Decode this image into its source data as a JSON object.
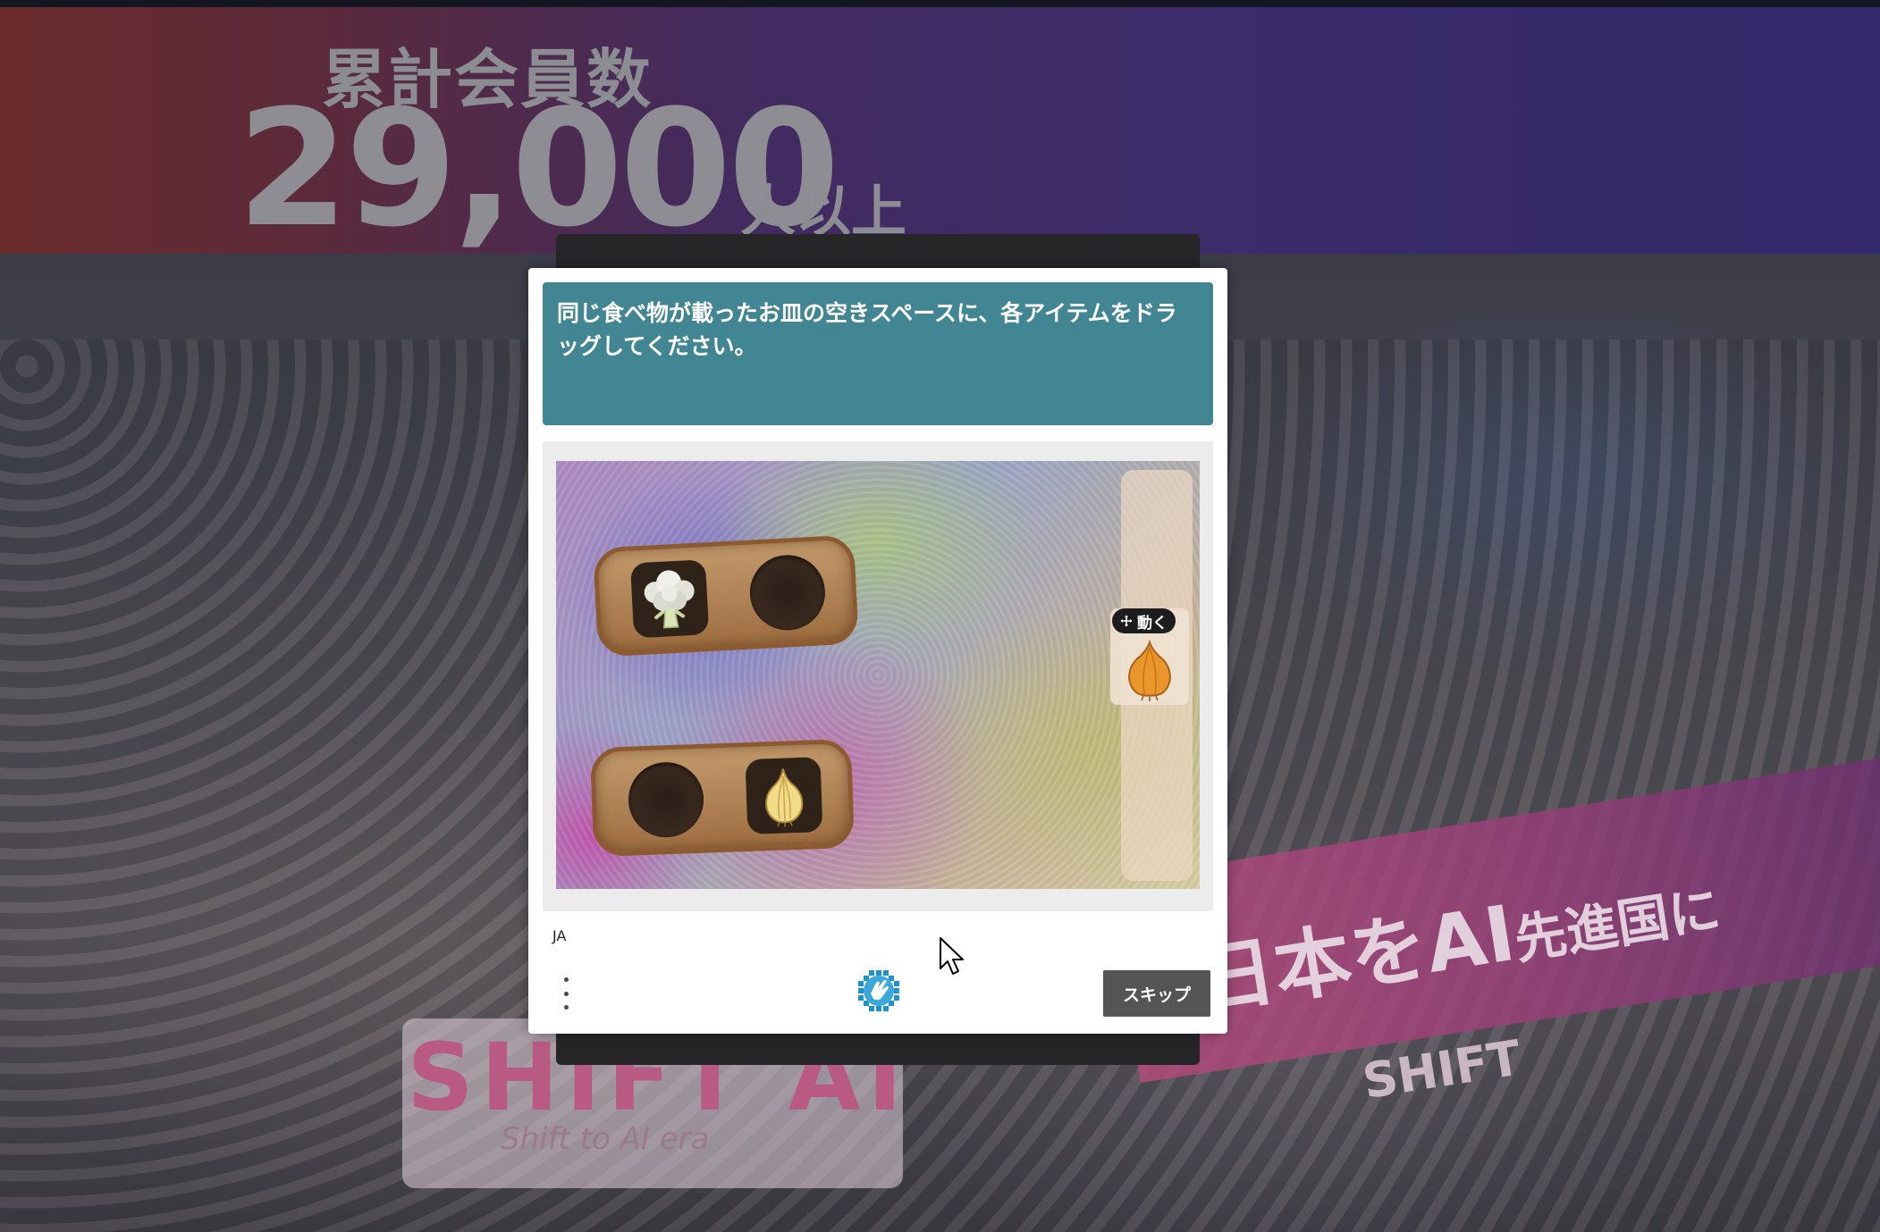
{
  "background": {
    "hero_label": "累計会員数",
    "hero_number": "29,000",
    "hero_unit": "人以上",
    "banner_text": "日本をAI",
    "banner_tail": "先進国に",
    "banner_sub": "SHIFT",
    "sign_text": "SHIFT AI",
    "sign_sub": "Shift to AI era"
  },
  "challenge": {
    "prompt": "同じ食べ物が載ったお皿の空きスペースに、各アイテムをドラッグしてください。",
    "plates": [
      {
        "filled_item": "broccoli",
        "filled_position": "left",
        "empty_position": "right"
      },
      {
        "filled_item": "onion",
        "filled_position": "right",
        "empty_position": "left"
      }
    ],
    "draggable": {
      "badge": "動く",
      "item": "onion"
    },
    "footer": {
      "language": "JA",
      "skip_label": "スキップ"
    }
  },
  "colors": {
    "prompt_bg": "#418692",
    "skip_bg": "#555555",
    "modal_bg": "#ffffff"
  }
}
